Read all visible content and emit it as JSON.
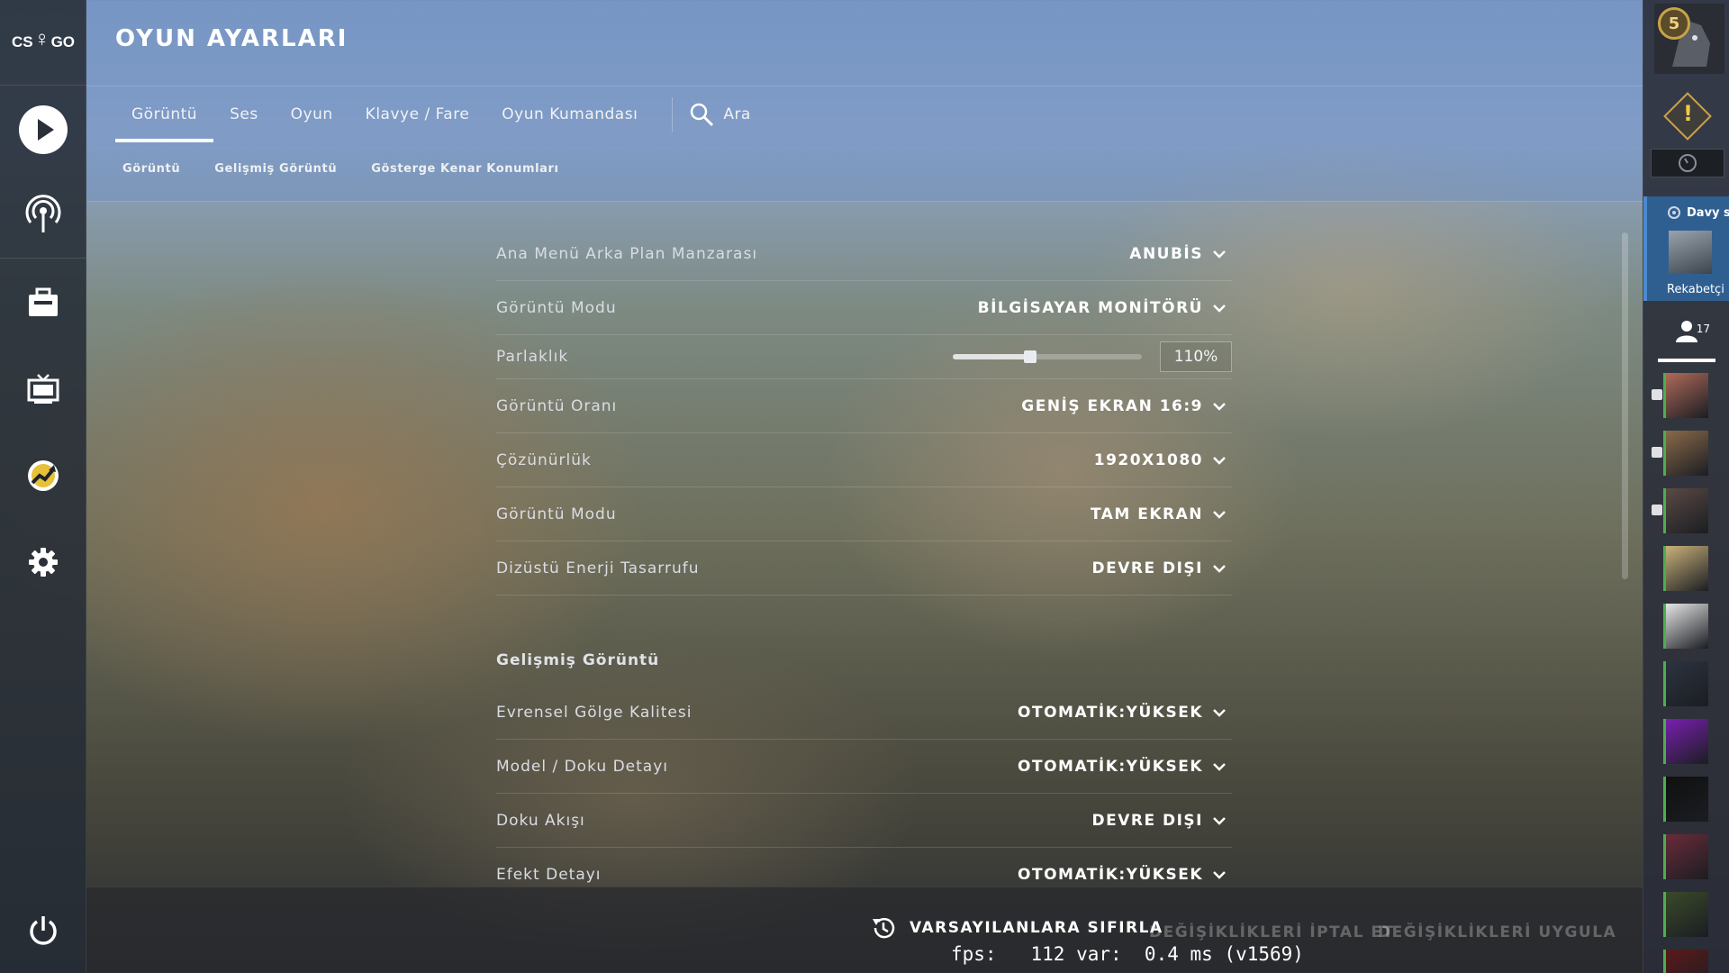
{
  "app": {
    "logo_text_left": "CS",
    "logo_text_right": "GO"
  },
  "page_title": "OYUN AYARLARI",
  "main_tabs": [
    {
      "label": "Görüntü",
      "active": true
    },
    {
      "label": "Ses",
      "active": false
    },
    {
      "label": "Oyun",
      "active": false
    },
    {
      "label": "Klavye / Fare",
      "active": false
    },
    {
      "label": "Oyun Kumandası",
      "active": false
    }
  ],
  "search": {
    "label": "Ara"
  },
  "sub_tabs": [
    "Görüntü",
    "Gelişmiş Görüntü",
    "Gösterge Kenar Konumları"
  ],
  "settings": {
    "rows": [
      {
        "label": "Ana Menü Arka Plan Manzarası",
        "value": "ANUBİS"
      },
      {
        "label": "Görüntü Modu",
        "value": "BİLGİSAYAR MONİTÖRÜ"
      },
      {
        "label": "Parlaklık",
        "value": "110%",
        "slider_fraction": 0.41
      },
      {
        "label": "Görüntü Oranı",
        "value": "GENİŞ EKRAN 16:9"
      },
      {
        "label": "Çözünürlük",
        "value": "1920X1080"
      },
      {
        "label": "Görüntü Modu",
        "value": "TAM EKRAN"
      },
      {
        "label": "Dizüstü Enerji Tasarrufu",
        "value": "DEVRE DIŞI"
      }
    ],
    "advanced_heading": "Gelişmiş Görüntü",
    "advanced_rows": [
      {
        "label": "Evrensel Gölge Kalitesi",
        "value": "OTOMATİK:YÜKSEK"
      },
      {
        "label": "Model / Doku Detayı",
        "value": "OTOMATİK:YÜKSEK"
      },
      {
        "label": "Doku Akışı",
        "value": "DEVRE DIŞI"
      },
      {
        "label": "Efekt Detayı",
        "value": "OTOMATİK:YÜKSEK"
      }
    ]
  },
  "bottom": {
    "reset_label": "VARSAYILANLARA SIFIRLA",
    "cancel_label": "DEĞİŞİKLİKLERİ İPTAL ET",
    "apply_label": "DEĞİŞİKLİKLERİ UYGULA",
    "fps_line": "fps:   112 var:  0.4 ms (v1569)"
  },
  "right_sidebar": {
    "profile_level": "5",
    "party_name": "Davy s",
    "party_mode": "Rekabetçi",
    "friends_count": "17",
    "friend_colors": [
      "#b06a5a",
      "#8a6a4a",
      "#5a4a44",
      "#c9b27a",
      "#e6e6e6",
      "#2c3440",
      "#7a1fb0",
      "#101010",
      "#6a2b3a",
      "#3a4a2a",
      "#5a1a1a"
    ]
  },
  "colors": {
    "accent": "#ffffff",
    "party_card": "#2f5f91",
    "online_bar": "#4caf50",
    "rank_gold": "#c9a24a"
  }
}
